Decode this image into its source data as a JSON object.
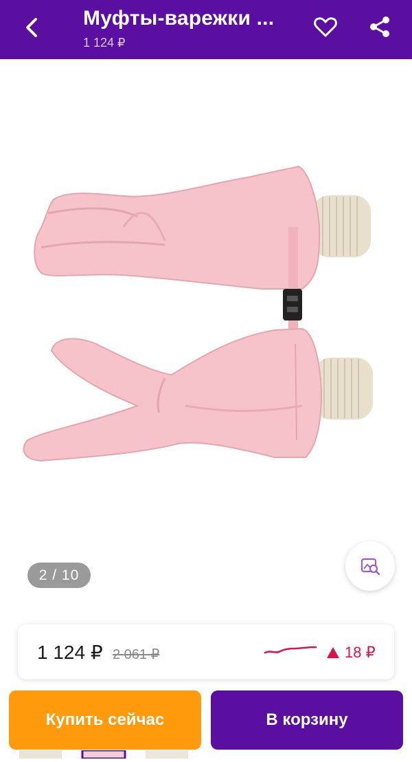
{
  "header": {
    "title": "Муфты-варежки ...",
    "price": "1 124 ₽",
    "icons": {
      "back": "chevron-left-icon",
      "favorite": "heart-icon",
      "share": "share-icon"
    }
  },
  "gallery": {
    "counter": "2 / 10",
    "search_icon": "image-search-icon"
  },
  "price_card": {
    "current": "1 124 ₽",
    "old": "2 061 ₽",
    "change": "18 ₽",
    "change_direction": "up",
    "change_color": "#d6154a"
  },
  "actions": {
    "buy_now": "Купить сейчас",
    "add_to_cart": "В корзину"
  },
  "colors": {
    "brand": "#5a0fa0",
    "buy_button": "#ff9a0c",
    "accent_red": "#d6154a"
  }
}
